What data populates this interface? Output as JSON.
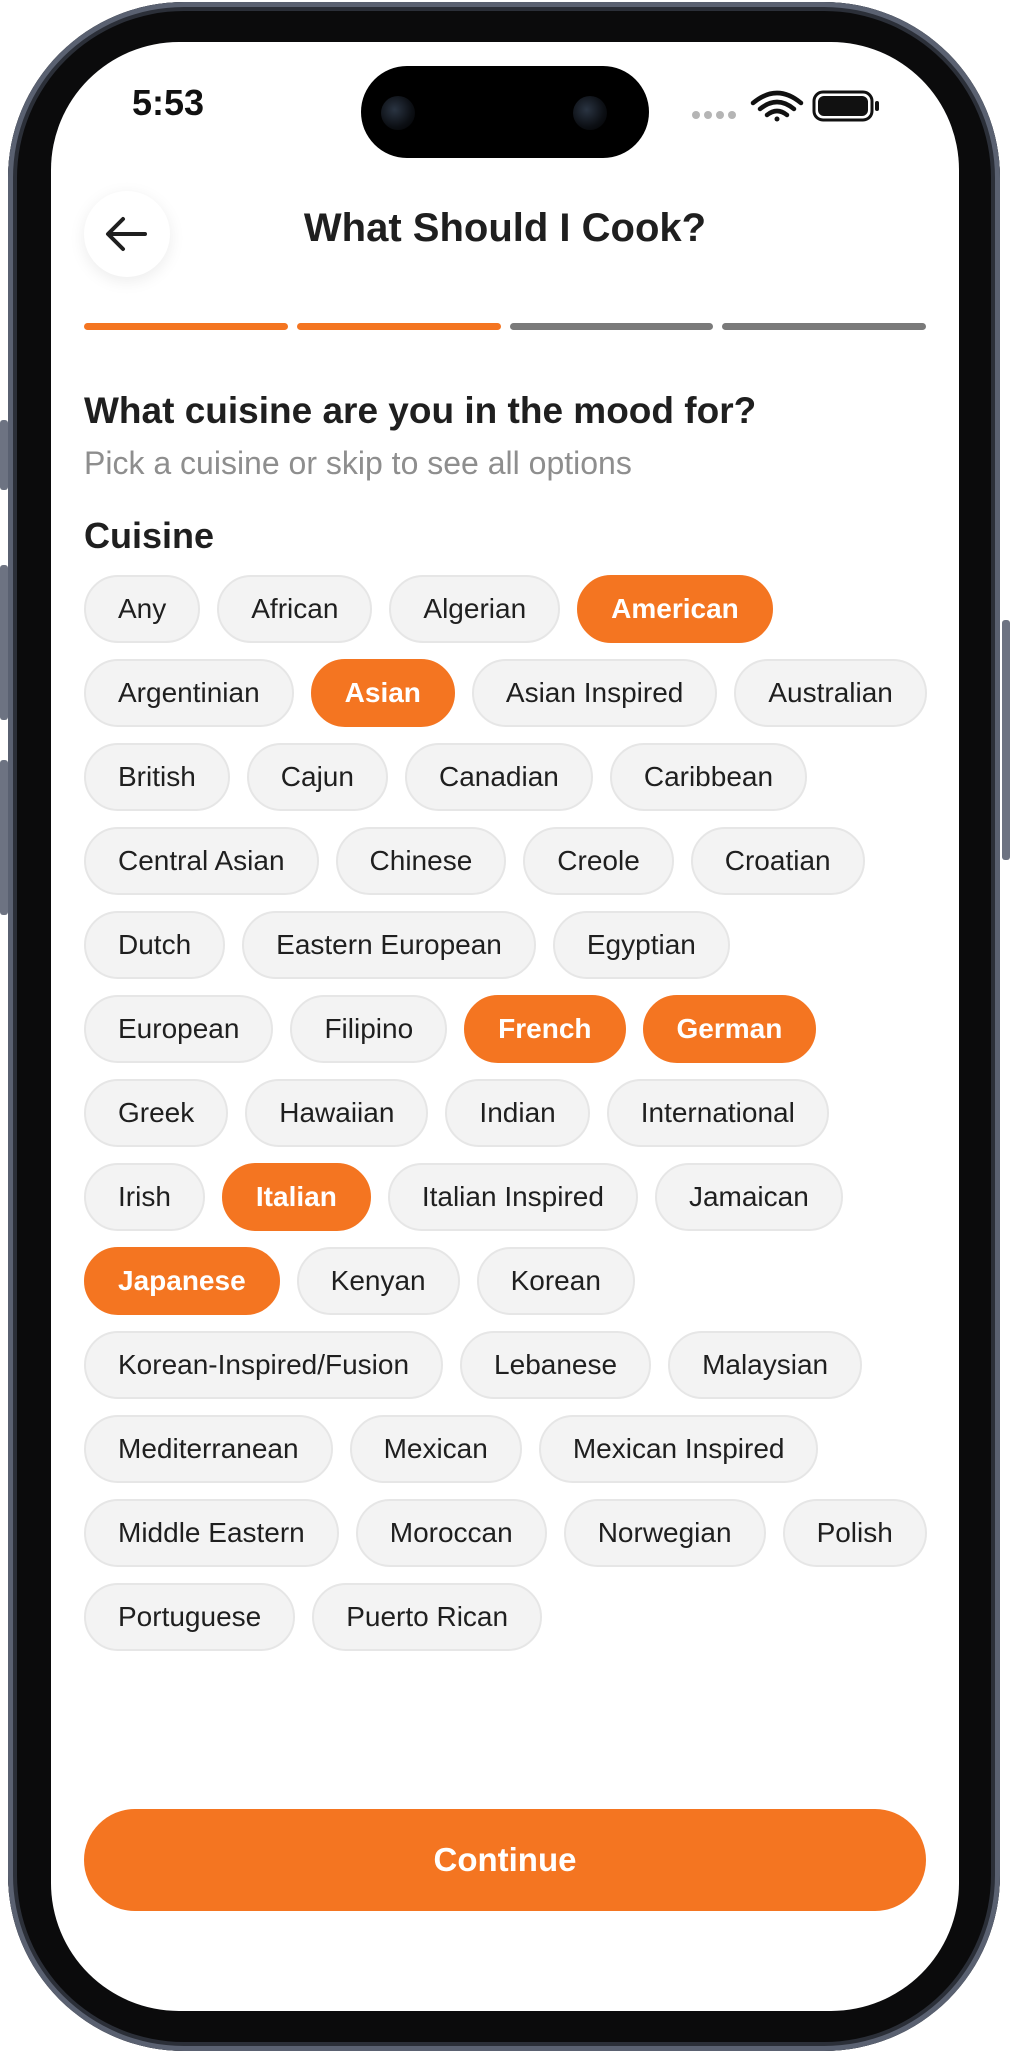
{
  "status_bar": {
    "time": "5:53"
  },
  "header": {
    "title": "What Should I Cook?",
    "progress": {
      "total_steps": 4,
      "completed_steps": 2
    }
  },
  "question": {
    "heading": "What cuisine are you in the mood for?",
    "subtitle": "Pick a cuisine or skip to see all options"
  },
  "section_label": "Cuisine",
  "cuisines": [
    {
      "label": "Any",
      "selected": false
    },
    {
      "label": "African",
      "selected": false
    },
    {
      "label": "Algerian",
      "selected": false
    },
    {
      "label": "American",
      "selected": true
    },
    {
      "label": "Argentinian",
      "selected": false
    },
    {
      "label": "Asian",
      "selected": true
    },
    {
      "label": "Asian Inspired",
      "selected": false
    },
    {
      "label": "Australian",
      "selected": false
    },
    {
      "label": "British",
      "selected": false
    },
    {
      "label": "Cajun",
      "selected": false
    },
    {
      "label": "Canadian",
      "selected": false
    },
    {
      "label": "Caribbean",
      "selected": false
    },
    {
      "label": "Central Asian",
      "selected": false
    },
    {
      "label": "Chinese",
      "selected": false
    },
    {
      "label": "Creole",
      "selected": false
    },
    {
      "label": "Croatian",
      "selected": false
    },
    {
      "label": "Dutch",
      "selected": false
    },
    {
      "label": "Eastern European",
      "selected": false
    },
    {
      "label": "Egyptian",
      "selected": false
    },
    {
      "label": "European",
      "selected": false
    },
    {
      "label": "Filipino",
      "selected": false
    },
    {
      "label": "French",
      "selected": true
    },
    {
      "label": "German",
      "selected": true
    },
    {
      "label": "Greek",
      "selected": false
    },
    {
      "label": "Hawaiian",
      "selected": false
    },
    {
      "label": "Indian",
      "selected": false
    },
    {
      "label": "International",
      "selected": false
    },
    {
      "label": "Irish",
      "selected": false
    },
    {
      "label": "Italian",
      "selected": true
    },
    {
      "label": "Italian Inspired",
      "selected": false
    },
    {
      "label": "Jamaican",
      "selected": false
    },
    {
      "label": "Japanese",
      "selected": true
    },
    {
      "label": "Kenyan",
      "selected": false
    },
    {
      "label": "Korean",
      "selected": false
    },
    {
      "label": "Korean-Inspired/Fusion",
      "selected": false
    },
    {
      "label": "Lebanese",
      "selected": false
    },
    {
      "label": "Malaysian",
      "selected": false
    },
    {
      "label": "Mediterranean",
      "selected": false
    },
    {
      "label": "Mexican",
      "selected": false
    },
    {
      "label": "Mexican Inspired",
      "selected": false
    },
    {
      "label": "Middle Eastern",
      "selected": false
    },
    {
      "label": "Moroccan",
      "selected": false
    },
    {
      "label": "Norwegian",
      "selected": false
    },
    {
      "label": "Polish",
      "selected": false
    },
    {
      "label": "Portuguese",
      "selected": false
    },
    {
      "label": "Puerto Rican",
      "selected": false
    }
  ],
  "continue_label": "Continue",
  "colors": {
    "accent": "#f47521",
    "chip_bg": "#f3f3f3",
    "text": "#1f1f1f",
    "muted": "#8e8e8e"
  },
  "icons": {
    "back": "arrow-left-icon",
    "signal": "signal-dots-icon",
    "wifi": "wifi-icon",
    "battery": "battery-icon"
  }
}
